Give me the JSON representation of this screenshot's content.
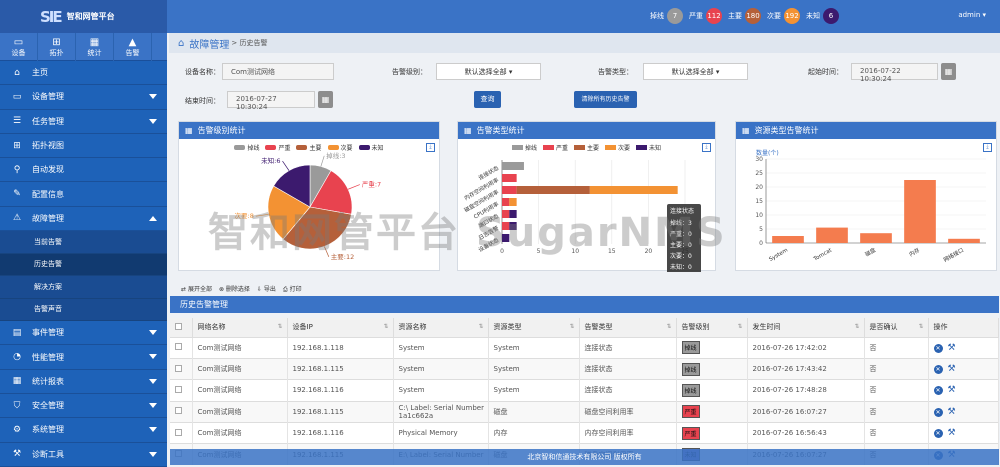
{
  "app": {
    "title": "智和网管平台",
    "logo_mark": "SIE"
  },
  "alarms": [
    {
      "label": "掉线",
      "count": "7",
      "color": "#9a9a9a"
    },
    {
      "label": "严重",
      "count": "112",
      "color": "#e8434f"
    },
    {
      "label": "主要",
      "count": "180",
      "color": "#b5603a"
    },
    {
      "label": "次要",
      "count": "192",
      "color": "#f39233"
    },
    {
      "label": "未知",
      "count": "6",
      "color": "#3c1a6e"
    }
  ],
  "user": "admin ▾",
  "quick_nav": [
    {
      "label": "设备",
      "icon": "▭"
    },
    {
      "label": "拓扑",
      "icon": "⊞"
    },
    {
      "label": "统计",
      "icon": "▦"
    },
    {
      "label": "告警",
      "icon": "▲"
    }
  ],
  "menu": [
    {
      "label": "主页",
      "icon": "⌂"
    },
    {
      "label": "设备管理",
      "icon": "▭"
    },
    {
      "label": "任务管理",
      "icon": "☰"
    },
    {
      "label": "拓扑视图",
      "icon": "⊞"
    },
    {
      "label": "自动发现",
      "icon": "⚲"
    },
    {
      "label": "配置信息",
      "icon": "✎"
    },
    {
      "label": "故障管理",
      "icon": "⚠"
    },
    {
      "label": "事件管理",
      "icon": "▤"
    },
    {
      "label": "性能管理",
      "icon": "◔"
    },
    {
      "label": "统计报表",
      "icon": "▦"
    },
    {
      "label": "安全管理",
      "icon": "⛉"
    },
    {
      "label": "系统管理",
      "icon": "⚙"
    },
    {
      "label": "诊断工具",
      "icon": "⚒"
    }
  ],
  "submenu": [
    "当前告警",
    "历史告警",
    "解决方案",
    "告警声音"
  ],
  "breadcrumb": {
    "title": "故障管理",
    "sub": "> 历史告警"
  },
  "filters": {
    "device_name_label": "设备名称：",
    "device_name_value": "Com测试网络",
    "alarm_level_label": "告警级别：",
    "alarm_level_value": "默认选择全部 ▾",
    "alarm_type_label": "告警类型：",
    "alarm_type_value": "默认选择全部 ▾",
    "start_label": "起始时间：",
    "start_value": "2016-07-22 10:30:24",
    "end_label": "结束时间：",
    "end_value": "2016-07-27 10:30:24",
    "query_btn": "查询",
    "clear_btn": "清除所有历史告警"
  },
  "panels": {
    "level": "告警级别统计",
    "type": "告警类型统计",
    "resource": "资源类型告警统计"
  },
  "chart_data": [
    {
      "type": "pie",
      "title": "告警级别统计",
      "legend": [
        "掉线",
        "严重",
        "主要",
        "次要",
        "未知"
      ],
      "slices": [
        {
          "name": "掉线",
          "value": 3,
          "color": "#9a9a9a"
        },
        {
          "name": "严重",
          "value": 7,
          "color": "#e8434f"
        },
        {
          "name": "主要",
          "value": 12,
          "color": "#b5603a"
        },
        {
          "name": "次要",
          "value": 8,
          "color": "#f39233"
        },
        {
          "name": "未知",
          "value": 6,
          "color": "#3c1a6e"
        }
      ],
      "labels": [
        "掉线:3",
        "严重:7",
        "主要:12",
        "次要:8",
        "未知:6"
      ]
    },
    {
      "type": "bar",
      "orientation": "horizontal",
      "stacked": true,
      "title": "告警类型统计",
      "categories": [
        "连接状态",
        "内存空间利用率",
        "磁盘空间利用率",
        "CPU利用率",
        "端口状态",
        "日志告警",
        "设备状态"
      ],
      "series": [
        {
          "name": "掉线",
          "color": "#9a9a9a",
          "values": [
            3,
            0,
            0,
            0,
            0,
            0,
            0
          ]
        },
        {
          "name": "严重",
          "color": "#e8434f",
          "values": [
            0,
            2,
            2,
            1,
            1,
            1,
            0
          ]
        },
        {
          "name": "主要",
          "color": "#b5603a",
          "values": [
            0,
            0,
            10,
            0,
            0,
            0,
            0
          ]
        },
        {
          "name": "次要",
          "color": "#f39233",
          "values": [
            0,
            0,
            12,
            1,
            0,
            0,
            0
          ]
        },
        {
          "name": "未知",
          "color": "#3c1a6e",
          "values": [
            0,
            0,
            0,
            0,
            1,
            1,
            1
          ]
        }
      ],
      "xlim": [
        0,
        25
      ],
      "xticks": [
        "0",
        "5",
        "10",
        "15",
        "20",
        "25"
      ],
      "tooltip": {
        "title": "连接状态",
        "rows": [
          "掉线：3",
          "严重：0",
          "主要：0",
          "次要：0",
          "未知：0"
        ]
      }
    },
    {
      "type": "bar",
      "title": "资源类型告警统计",
      "ylabel": "数量(个)",
      "categories": [
        "System",
        "Tomcat",
        "磁盘",
        "内存",
        "网络接口"
      ],
      "values": [
        2.5,
        5.5,
        3.5,
        22.5,
        1.5
      ],
      "color": "#f47c4e",
      "ylim": [
        0,
        30
      ],
      "yticks": [
        "0",
        "5",
        "10",
        "15",
        "20",
        "25",
        "30"
      ]
    }
  ],
  "toolbar": [
    "展开全部",
    "删除选择",
    "导出",
    "打印"
  ],
  "table": {
    "title": "历史告警管理",
    "headers": [
      "网络名称",
      "设备IP",
      "资源名称",
      "资源类型",
      "告警类型",
      "告警级别",
      "发生时间",
      "是否确认",
      "操作"
    ],
    "rows": [
      [
        "Com测试网络",
        "192.168.1.118",
        "System",
        "System",
        "连接状态",
        "掉线",
        "2016-07-26 17:42:02",
        "否"
      ],
      [
        "Com测试网络",
        "192.168.1.115",
        "System",
        "System",
        "连接状态",
        "掉线",
        "2016-07-26 17:43:42",
        "否"
      ],
      [
        "Com测试网络",
        "192.168.1.116",
        "System",
        "System",
        "连接状态",
        "掉线",
        "2016-07-26 17:48:28",
        "否"
      ],
      [
        "Com测试网络",
        "192.168.1.115",
        "C:\\ Label: Serial Number 1a1c662a",
        "磁盘",
        "磁盘空间利用率",
        "严重",
        "2016-07-26 16:07:27",
        "否"
      ],
      [
        "Com测试网络",
        "192.168.1.116",
        "Physical Memory",
        "内存",
        "内存空间利用率",
        "严重",
        "2016-07-26 16:56:43",
        "否"
      ],
      [
        "Com测试网络",
        "192.168.1.115",
        "E:\\ Label: Serial Number",
        "磁盘",
        "磁盘空间利用率",
        "未知",
        "2016-07-26 16:07:27",
        "否"
      ]
    ],
    "level_colors": {
      "掉线": "#9a9a9a",
      "严重": "#e8434f",
      "未知": "#7a6fb3"
    }
  },
  "footer": "北京智和信通技术有限公司 版权所有",
  "watermark": "智和网管平台 SugarNMS"
}
